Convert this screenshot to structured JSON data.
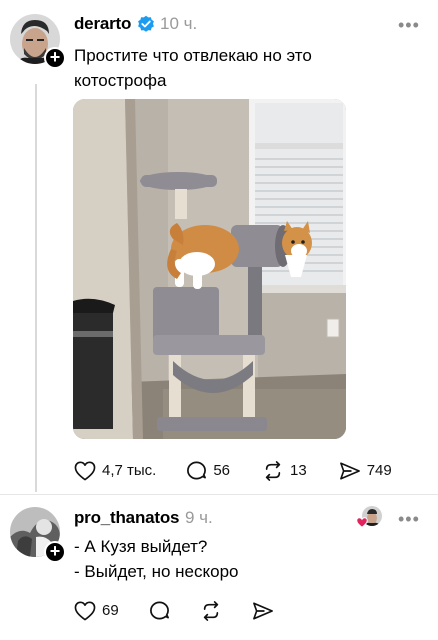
{
  "post": {
    "username": "derarto",
    "verified": true,
    "time": "10 ч.",
    "text_line1": "Простите что отвлекаю но это",
    "text_line2": "котострофа",
    "stats": {
      "likes": "4,7 тыс.",
      "comments": "56",
      "reposts": "13",
      "shares": "749"
    }
  },
  "reply": {
    "username": "pro_thanatos",
    "time": "9 ч.",
    "text_line1": "- А Кузя выйдет?",
    "text_line2": "- Выйдет, но нескоро",
    "stats": {
      "likes": "69"
    }
  },
  "icons": {
    "more": "more-dots-icon",
    "like": "heart-icon",
    "comment": "comment-bubble-icon",
    "repost": "repost-arrows-icon",
    "share": "send-arrow-icon",
    "verified": "verified-badge-icon",
    "follow": "plus-icon"
  },
  "colors": {
    "verified": "#1d9bf0",
    "muted": "#9a9a9a",
    "liked_heart": "#e0245e"
  }
}
